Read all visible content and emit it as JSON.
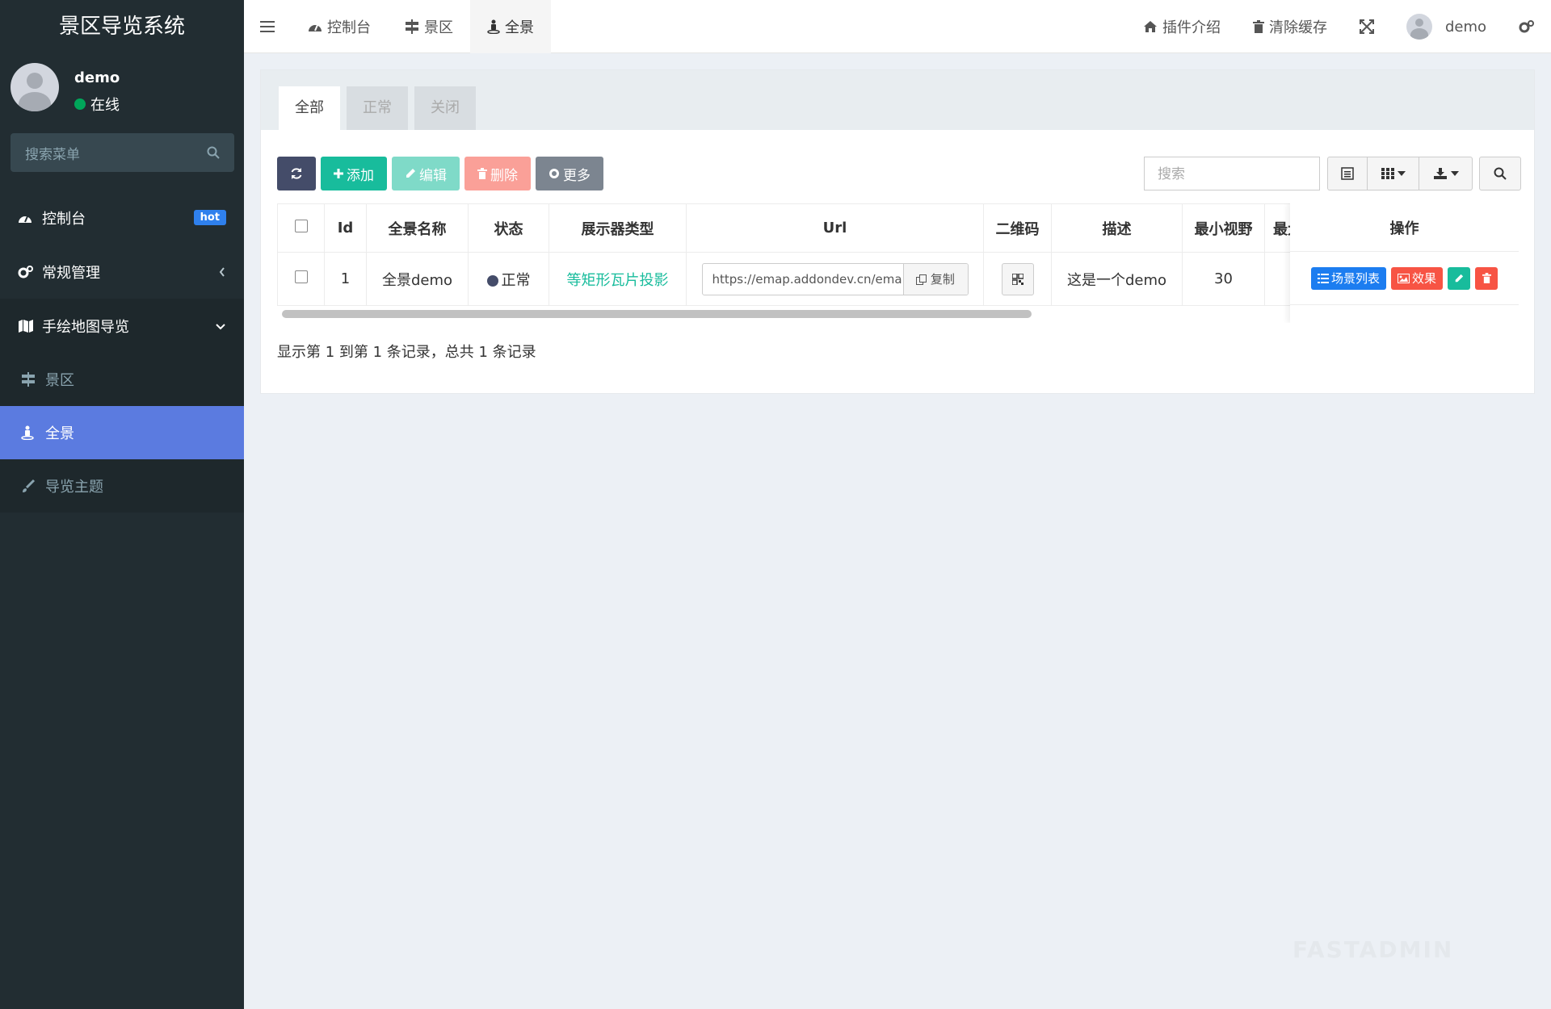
{
  "sidebar": {
    "brand": "景区导览系统",
    "user": {
      "name": "demo",
      "status": "在线"
    },
    "search_placeholder": "搜索菜单",
    "items": [
      {
        "label": "控制台",
        "badge": "hot"
      },
      {
        "label": "常规管理"
      },
      {
        "label": "手绘地图导览",
        "children": [
          {
            "label": "景区"
          },
          {
            "label": "全景"
          },
          {
            "label": "导览主题"
          }
        ]
      }
    ]
  },
  "topbar": {
    "tabs": [
      {
        "label": "控制台"
      },
      {
        "label": "景区"
      },
      {
        "label": "全景"
      }
    ],
    "right": {
      "plugin_intro": "插件介绍",
      "clear_cache": "清除缓存",
      "username": "demo"
    }
  },
  "panel": {
    "tabs": [
      "全部",
      "正常",
      "关闭"
    ],
    "toolbar": {
      "add": "添加",
      "edit": "编辑",
      "delete": "删除",
      "more": "更多",
      "search_placeholder": "搜索"
    },
    "table": {
      "columns": [
        "Id",
        "全景名称",
        "状态",
        "展示器类型",
        "Url",
        "二维码",
        "描述",
        "最小视野",
        "最大"
      ],
      "op_column": "操作",
      "rows": [
        {
          "id": "1",
          "name": "全景demo",
          "status": "正常",
          "viewer_type": "等矩形瓦片投影",
          "url": "https://emap.addondev.cn/ema",
          "copy": "复制",
          "description": "这是一个demo",
          "min_fov": "30",
          "ops": {
            "scene_list": "场景列表",
            "effect": "效果"
          }
        }
      ]
    },
    "pagination": "显示第 1 到第 1 条记录，总共 1 条记录"
  },
  "watermark": "FASTADMIN",
  "colors": {
    "sidebar_bg": "#222d32",
    "active_menu": "#5b7be0",
    "success": "#18bc9c",
    "danger": "#f75444",
    "primary": "#1c7df0"
  }
}
